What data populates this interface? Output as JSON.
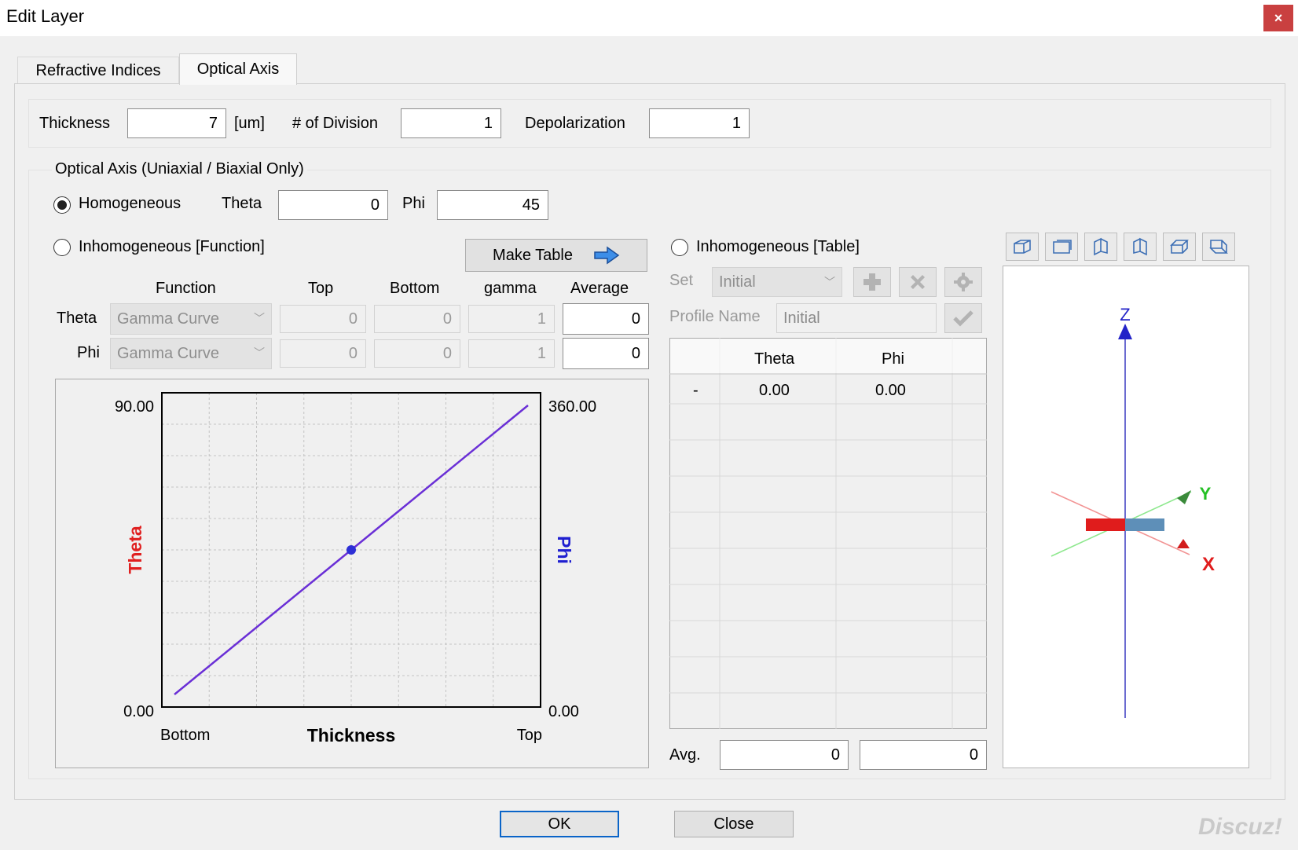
{
  "window": {
    "title": "Edit Layer",
    "close_glyph": "×"
  },
  "tabs": [
    {
      "label": "Refractive Indices",
      "active": false
    },
    {
      "label": "Optical Axis",
      "active": true
    }
  ],
  "thickness": {
    "label": "Thickness",
    "value": "7",
    "unit": "[um]"
  },
  "division": {
    "label": "# of Division",
    "value": "1"
  },
  "depolarization": {
    "label": "Depolarization",
    "value": "1"
  },
  "optical_axis": {
    "group_label": "Optical Axis (Uniaxial / Biaxial Only)",
    "homogeneous": {
      "label": "Homogeneous",
      "selected": true,
      "theta_label": "Theta",
      "theta_value": "0",
      "phi_label": "Phi",
      "phi_value": "45"
    },
    "inhomogeneous_function": {
      "label": "Inhomogeneous [Function]",
      "selected": false,
      "make_table_label": "Make Table",
      "columns": [
        "Function",
        "Top",
        "Bottom",
        "gamma",
        "Average"
      ],
      "rows": [
        {
          "name": "Theta",
          "function": "Gamma Curve",
          "top": "0",
          "bottom": "0",
          "gamma": "1",
          "average": "0"
        },
        {
          "name": "Phi",
          "function": "Gamma Curve",
          "top": "0",
          "bottom": "0",
          "gamma": "1",
          "average": "0"
        }
      ]
    },
    "inhomogeneous_table": {
      "label": "Inhomogeneous [Table]",
      "selected": false,
      "set_label": "Set",
      "set_value": "Initial",
      "profile_label": "Profile Name",
      "profile_value": "Initial",
      "columns": [
        "Theta",
        "Phi"
      ],
      "rows": [
        {
          "marker": "-",
          "theta": "0.00",
          "phi": "0.00"
        }
      ],
      "avg_label": "Avg.",
      "avg_theta": "0",
      "avg_phi": "0"
    }
  },
  "chart_data": {
    "type": "line",
    "xlabel": "Thickness",
    "x_tick_labels": [
      "Bottom",
      "Top"
    ],
    "ylabel_left": "Theta",
    "ylabel_right": "Phi",
    "ylim_left": [
      0,
      90
    ],
    "ylim_right": [
      0,
      360
    ],
    "left_tick_labels": [
      "90.00",
      "0.00"
    ],
    "right_tick_labels": [
      "360.00",
      "0.00"
    ],
    "grid": true,
    "series": [
      {
        "x": [
          0.0,
          0.5,
          1.0
        ],
        "y": [
          0,
          45,
          90
        ],
        "color": "#6a2fd6"
      }
    ],
    "marker": {
      "x": 0.5,
      "y": 45,
      "color": "#2d2fd6"
    },
    "colors": {
      "theta": "#e02020",
      "phi": "#1f1fd0"
    }
  },
  "axes_view": {
    "labels": {
      "z": "Z",
      "y": "Y",
      "x": "X"
    },
    "view_buttons": [
      "view-iso-icon",
      "view-front-icon",
      "view-left-icon",
      "view-right-icon",
      "view-top-icon",
      "view-bottom-icon"
    ]
  },
  "footer": {
    "ok_label": "OK",
    "close_label": "Close"
  },
  "watermark": "Discuz!"
}
